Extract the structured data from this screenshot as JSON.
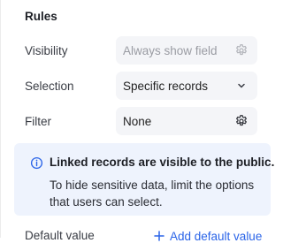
{
  "rules": {
    "title": "Rules",
    "visibility": {
      "label": "Visibility",
      "value": "Always show field",
      "icon": "gear-icon"
    },
    "selection": {
      "label": "Selection",
      "value": "Specific records",
      "icon": "chevron-down-icon"
    },
    "filter": {
      "label": "Filter",
      "value": "None",
      "icon": "gear-icon"
    }
  },
  "notice": {
    "icon": "info-icon",
    "title": "Linked records are visible to the public.",
    "body": "To hide sensitive data, limit the options that users can select."
  },
  "default_value": {
    "label": "Default value",
    "add_label": "Add default value",
    "add_icon": "plus-icon"
  },
  "colors": {
    "field_bg": "#f4f5f8",
    "notice_bg": "#eef3fd",
    "link": "#2a64e8",
    "info_icon": "#2a64e8"
  }
}
